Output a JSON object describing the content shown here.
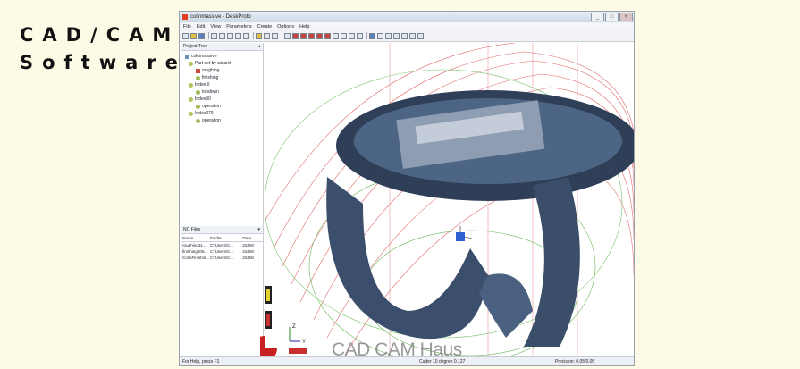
{
  "side_title": {
    "line1": "CAD/CAM",
    "line2": "Software"
  },
  "window": {
    "title": "colinmassive - DeskProto",
    "controls": [
      "minimize",
      "maximize",
      "close"
    ]
  },
  "menu": [
    "File",
    "Edit",
    "View",
    "Parameters",
    "Create",
    "Options",
    "Help"
  ],
  "project_tree": {
    "header": "Project Tree",
    "items": [
      {
        "label": "colinmassive",
        "level": 0,
        "icon": "project-icon"
      },
      {
        "label": "Part set by wizard",
        "level": 1,
        "icon": "part-icon"
      },
      {
        "label": "roughing",
        "level": 2,
        "icon": "operation-icon"
      },
      {
        "label": "finishing",
        "level": 2,
        "icon": "operation-icon"
      },
      {
        "label": "Index 0",
        "level": 1,
        "icon": "part-icon"
      },
      {
        "label": "topdown",
        "level": 2,
        "icon": "operation-icon"
      },
      {
        "label": "Index90",
        "level": 1,
        "icon": "part-icon"
      },
      {
        "label": "operation",
        "level": 2,
        "icon": "operation-icon"
      },
      {
        "label": "Index270",
        "level": 1,
        "icon": "part-icon"
      },
      {
        "label": "operation",
        "level": 2,
        "icon": "operation-icon"
      }
    ]
  },
  "nc_files": {
    "header": "NC Files",
    "columns": [
      "Name",
      "Folder",
      "Date"
    ],
    "rows": [
      [
        "roughing31...",
        "C:\\Users\\C...",
        "22/06/"
      ],
      [
        "finishing.t06...",
        "C:\\Users\\C...",
        "22/06/"
      ],
      [
        "ColinFinishin...",
        "C:\\Users\\C...",
        "22/06/"
      ]
    ]
  },
  "status": {
    "help": "For Help, press F1",
    "cutter": "Cutter 10 degree 0.127",
    "precision": "Precision: 0.05/0.05"
  },
  "watermark": "CAD CAM Haus",
  "axes": {
    "z": "Z",
    "y": "Y"
  },
  "colors": {
    "toolpath_red": "#e05a5a",
    "toolpath_green": "#6ab85a",
    "ring_body": "#3a4f6a",
    "background": "#fdfbe6"
  }
}
